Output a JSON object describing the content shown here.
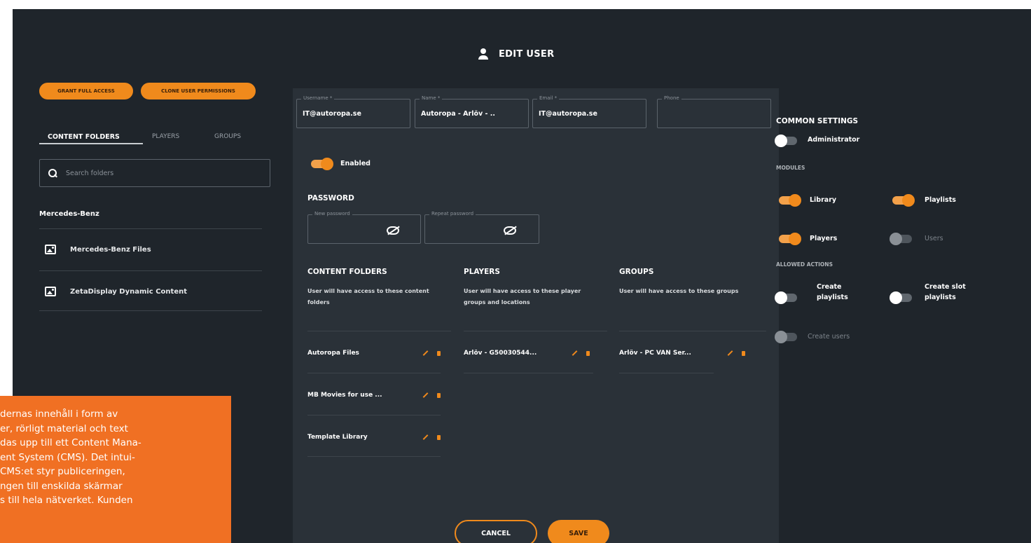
{
  "dialog": {
    "title": "EDIT USER"
  },
  "left": {
    "grant_full_access": "GRANT FULL ACCESS",
    "clone_permissions": "CLONE USER PERMISSIONS",
    "tabs": [
      "CONTENT FOLDERS",
      "PLAYERS",
      "GROUPS"
    ],
    "search_placeholder": "Search folders",
    "group_name": "Mercedes-Benz",
    "folders": [
      "Mercedes-Benz Files",
      "ZetaDisplay Dynamic Content"
    ]
  },
  "form": {
    "username_label": "Username *",
    "username_value": "IT@autoropa.se",
    "name_label": "Name *",
    "name_value": "Autoropa - Arlöv - ..",
    "email_label": "Email *",
    "email_value": "IT@autoropa.se",
    "phone_label": "Phone",
    "phone_value": "",
    "enabled_label": "Enabled",
    "password_title": "PASSWORD",
    "new_password_label": "New password",
    "repeat_password_label": "Repeat password"
  },
  "access": {
    "content_folders": {
      "title": "CONTENT FOLDERS",
      "description": "User will have access to these content folders",
      "items": [
        "Autoropa Files",
        "MB Movies for use ...",
        "Template Library"
      ]
    },
    "players": {
      "title": "PLAYERS",
      "description": "User will have access to these player groups and locations",
      "items": [
        "Arlöv - G50030544..."
      ]
    },
    "groups": {
      "title": "GROUPS",
      "description": "User will have access to these groups",
      "items": [
        "Arlöv - PC VAN Ser..."
      ]
    }
  },
  "buttons": {
    "cancel": "CANCEL",
    "save": "SAVE"
  },
  "settings": {
    "title": "COMMON SETTINGS",
    "administrator": "Administrator",
    "modules_title": "MODULES",
    "library": "Library",
    "playlists": "Playlists",
    "players": "Players",
    "users": "Users",
    "actions_title": "ALLOWED ACTIONS",
    "create_playlists_line1": "Create",
    "create_playlists_line2": "playlists",
    "create_slot_line1": "Create slot",
    "create_slot_line2": "playlists",
    "create_users": "Create users"
  },
  "overlay": {
    "lines": [
      "dernas innehåll i form av",
      "er, rörligt material och text",
      "das upp till ett Content Mana-",
      "ent System (CMS). Det intui-",
      " CMS:et styr publiceringen,",
      "ngen till enskilda skärmar",
      "s till hela nätverket. Kunden"
    ]
  },
  "colors": {
    "accent": "#f08a1c",
    "background": "#1f252b",
    "panel": "#2a3138",
    "overlay": "#f07023"
  }
}
